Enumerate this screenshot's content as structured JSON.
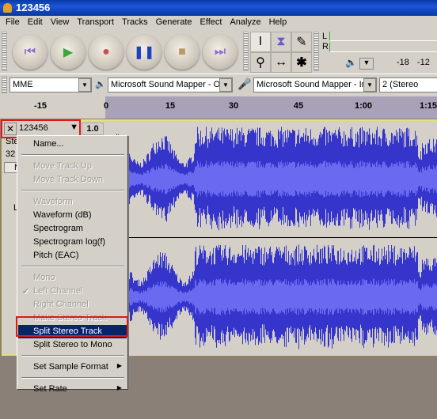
{
  "window": {
    "title": "123456"
  },
  "menubar": [
    "File",
    "Edit",
    "View",
    "Transport",
    "Tracks",
    "Generate",
    "Effect",
    "Analyze",
    "Help"
  ],
  "transport": [
    {
      "name": "skip-start",
      "glyph": "⏮",
      "color": "#8a6fd0"
    },
    {
      "name": "play",
      "glyph": "▶",
      "color": "#3aa83a"
    },
    {
      "name": "record",
      "glyph": "●",
      "color": "#c85050"
    },
    {
      "name": "pause",
      "glyph": "❚❚",
      "color": "#2040c0"
    },
    {
      "name": "stop",
      "glyph": "■",
      "color": "#b89a66"
    },
    {
      "name": "skip-end",
      "glyph": "⏭",
      "color": "#8a6fd0"
    }
  ],
  "tools": {
    "selection": "I",
    "envelope": "⧗",
    "draw": "✎",
    "zoom": "⚲",
    "timeshift": "↔",
    "multi": "✱"
  },
  "meter": {
    "left": "L",
    "right": "R",
    "ticks": [
      "-18",
      "-12"
    ]
  },
  "devices": {
    "host": "MME",
    "output": "Microsoft Sound Mapper - Out",
    "input": "Microsoft Sound Mapper - Inpu",
    "channels": "2 (Stereo"
  },
  "ruler": {
    "ticks": [
      "-15",
      "0",
      "15",
      "30",
      "45",
      "1:00",
      "1:15"
    ]
  },
  "track": {
    "name": "123456",
    "gain": "1.0",
    "info1": "Ste",
    "info2": "32",
    "mute": "M",
    "l1": "L"
  },
  "context_menu": {
    "items": [
      {
        "label": "Name...",
        "enabled": true
      },
      {
        "sep": true
      },
      {
        "label": "Move Track Up",
        "enabled": false
      },
      {
        "label": "Move Track Down",
        "enabled": false
      },
      {
        "sep": true
      },
      {
        "label": "Waveform",
        "enabled": false
      },
      {
        "label": "Waveform (dB)",
        "enabled": true
      },
      {
        "label": "Spectrogram",
        "enabled": true
      },
      {
        "label": "Spectrogram log(f)",
        "enabled": true
      },
      {
        "label": "Pitch (EAC)",
        "enabled": true
      },
      {
        "sep": true
      },
      {
        "label": "Mono",
        "enabled": false
      },
      {
        "label": "Left Channel",
        "enabled": false,
        "checked": true
      },
      {
        "label": "Right Channel",
        "enabled": false
      },
      {
        "label": "Make Stereo Track",
        "enabled": false
      },
      {
        "label": "Split Stereo Track",
        "enabled": true,
        "highlighted": true
      },
      {
        "label": "Split Stereo to Mono",
        "enabled": true
      },
      {
        "sep": true
      },
      {
        "label": "Set Sample Format",
        "enabled": true,
        "submenu": true
      },
      {
        "sep": true
      },
      {
        "label": "Set Rate",
        "enabled": true,
        "submenu": true
      }
    ]
  },
  "colors": {
    "waveform": "#3535cc",
    "waveform_rms": "#6a6af0",
    "highlight": "#0a246a",
    "annotation": "#e01818"
  }
}
